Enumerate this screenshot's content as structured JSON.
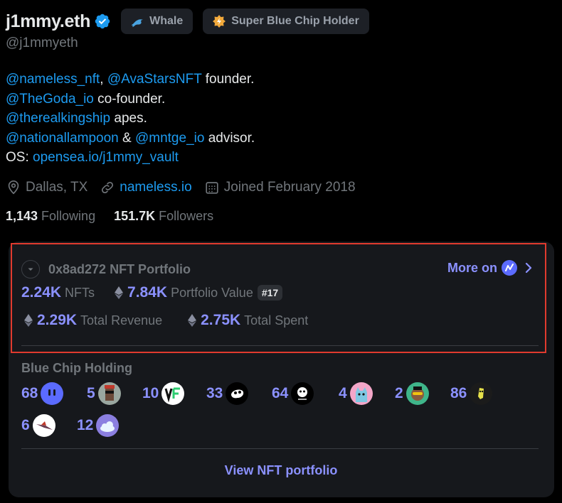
{
  "profile": {
    "display_name": "j1mmy.eth",
    "handle": "@j1mmyeth",
    "badges": [
      {
        "label": "Whale",
        "icon": "dolphin-icon"
      },
      {
        "label": "Super Blue Chip Holder",
        "icon": "bluechip-icon"
      }
    ],
    "bio": {
      "l1_link1": "@nameless_nft",
      "l1_sep": ", ",
      "l1_link2": "@AvaStarsNFT",
      "l1_text": " founder.",
      "l2_link": "@TheGoda_io",
      "l2_text": " co-founder.",
      "l3_link": "@therealkingship",
      "l3_text": " apes.",
      "l4_link1": "@nationallampoon",
      "l4_sep": " & ",
      "l4_link2": "@mntge_io",
      "l4_text": " advisor.",
      "l5_prefix": "OS: ",
      "l5_link": "opensea.io/j1mmy_vault"
    },
    "location": "Dallas, TX",
    "website": "nameless.io",
    "joined": "Joined February 2018",
    "following_count": "1,143",
    "following_label": "Following",
    "followers_count": "151.7K",
    "followers_label": "Followers"
  },
  "portfolio": {
    "title": "0x8ad272 NFT Portfolio",
    "more_on": "More on",
    "nfts_value": "2.24K",
    "nfts_label": "NFTs",
    "portfolio_value": "7.84K",
    "portfolio_label": "Portfolio Value",
    "rank": "#17",
    "revenue_value": "2.29K",
    "revenue_label": "Total Revenue",
    "spent_value": "2.75K",
    "spent_label": "Total Spent"
  },
  "blue_chip": {
    "title": "Blue Chip Holding",
    "holdings": [
      {
        "count": "68",
        "icon": "ghost-avatar-icon",
        "bg": "#5b6bff"
      },
      {
        "count": "5",
        "icon": "punk-avatar-icon",
        "bg": "#9aa7a0"
      },
      {
        "count": "10",
        "icon": "vf-avatar-icon",
        "bg": "#ffffff"
      },
      {
        "count": "33",
        "icon": "skull-avatar-icon",
        "bg": "#000000"
      },
      {
        "count": "64",
        "icon": "bayc-avatar-icon",
        "bg": "#000000"
      },
      {
        "count": "4",
        "icon": "cat-avatar-icon",
        "bg": "#f3a6c8"
      },
      {
        "count": "2",
        "icon": "ape-avatar-icon",
        "bg": "#3fb58a"
      },
      {
        "count": "86",
        "icon": "alien-avatar-icon",
        "bg": "#1b1b1b"
      },
      {
        "count": "6",
        "icon": "bird-avatar-icon",
        "bg": "#ffffff"
      },
      {
        "count": "12",
        "icon": "cloud-avatar-icon",
        "bg": "#8b7fe0"
      }
    ]
  },
  "view_portfolio": "View NFT portfolio",
  "colors": {
    "accent": "#8b91ff",
    "link": "#1d9bf0",
    "highlight_border": "#e03a2e"
  }
}
